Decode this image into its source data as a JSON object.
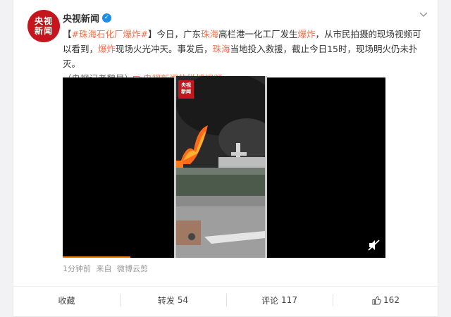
{
  "author": {
    "avatar_line1": "央视",
    "avatar_line2": "新闻",
    "name": "央视新闻",
    "verified_mark": "✓"
  },
  "post": {
    "open_bracket": "【",
    "hashtag": "#珠海石化厂爆炸#",
    "close_bracket": "】",
    "t1": "今日，广东",
    "k1": "珠海",
    "t2": "高栏港一化工厂发生",
    "k2": "爆炸",
    "t3": "，从市民拍摄的现场视频可以看到，",
    "k3": "爆炸",
    "t4": "现场火光冲天。事发后，",
    "k4": "珠海",
    "t5": "当地投入救援，截止今日15时，现场明火仍未扑灭。",
    "reporter": "（央视记者魏昱）",
    "video_link": "央视新闻的微博视频"
  },
  "video": {
    "watermark_line1": "央视",
    "watermark_line2": "新闻",
    "progress": 0.21
  },
  "meta": {
    "time": "1分钟前",
    "source_prefix": "来自",
    "source": "微博云剪"
  },
  "actions": {
    "favorite": "收藏",
    "repost_label": "转发",
    "repost_count": "54",
    "comment_label": "评论",
    "comment_count": "117",
    "like_count": "162"
  },
  "colors": {
    "brand_red": "#c4161c",
    "link_orange": "#eb7350",
    "progress_orange": "#ff8200"
  }
}
